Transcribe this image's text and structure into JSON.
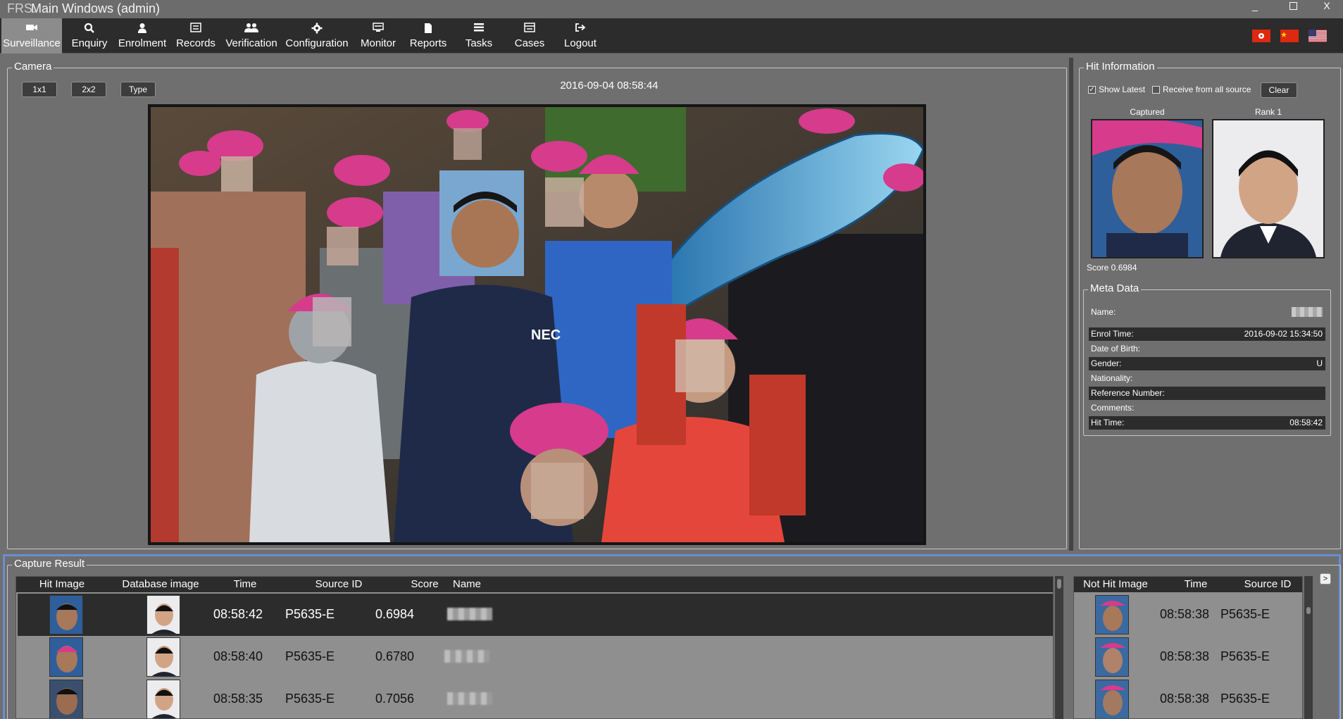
{
  "titlebar": {
    "brand": "FRS.",
    "title": "Main Windows   (admin)",
    "minimize": "_",
    "close": "X"
  },
  "toolbar": {
    "items": [
      {
        "label": "Surveillance",
        "icon": "video-camera-icon"
      },
      {
        "label": "Enquiry",
        "icon": "search-icon"
      },
      {
        "label": "Enrolment",
        "icon": "user-icon"
      },
      {
        "label": "Records",
        "icon": "records-icon"
      },
      {
        "label": "Verification",
        "icon": "users-icon"
      },
      {
        "label": "Configuration",
        "icon": "gear-icon"
      },
      {
        "label": "Monitor",
        "icon": "monitor-icon"
      },
      {
        "label": "Reports",
        "icon": "report-icon"
      },
      {
        "label": "Tasks",
        "icon": "list-icon"
      },
      {
        "label": "Cases",
        "icon": "cases-icon"
      },
      {
        "label": "Logout",
        "icon": "logout-icon"
      }
    ],
    "active": "Surveillance",
    "languages": [
      "hong-kong-flag",
      "china-flag",
      "us-flag"
    ]
  },
  "camera": {
    "legend": "Camera",
    "buttons": {
      "one": "1x1",
      "two": "2x2",
      "type": "Type"
    },
    "timestamp": "2016-09-04 08:58:44",
    "overlay_text": "NEC"
  },
  "hit_information": {
    "legend": "Hit Information",
    "show_latest": {
      "label": "Show Latest",
      "checked": true
    },
    "receive_all": {
      "label": "Receive from all source",
      "checked": false
    },
    "clear": "Clear",
    "captured_label": "Captured",
    "rank_label": "Rank 1",
    "score": "Score 0.6984"
  },
  "meta_data": {
    "legend": "Meta Data",
    "rows": [
      {
        "label": "Name:",
        "value": ""
      },
      {
        "label": "Enrol Time:",
        "value": "2016-09-02 15:34:50"
      },
      {
        "label": "Date of Birth:",
        "value": ""
      },
      {
        "label": "Gender:",
        "value": "U"
      },
      {
        "label": "Nationality:",
        "value": ""
      },
      {
        "label": "Reference Number:",
        "value": ""
      },
      {
        "label": "Comments:",
        "value": ""
      },
      {
        "label": "Hit Time:",
        "value": "08:58:42"
      }
    ]
  },
  "capture_result": {
    "legend": "Capture Result",
    "hit_columns": [
      "Hit Image",
      "Database image",
      "Time",
      "Source ID",
      "Score",
      "Name"
    ],
    "hit_rows": [
      {
        "time": "08:58:42",
        "source": "P5635-E",
        "score": "0.6984",
        "selected": true
      },
      {
        "time": "08:58:40",
        "source": "P5635-E",
        "score": "0.6780",
        "selected": false
      },
      {
        "time": "08:58:35",
        "source": "P5635-E",
        "score": "0.7056",
        "selected": false
      }
    ],
    "nohit_columns": [
      "Not Hit Image",
      "Time",
      "Source ID"
    ],
    "nohit_rows": [
      {
        "time": "08:58:38",
        "source": "P5635-E"
      },
      {
        "time": "08:58:38",
        "source": "P5635-E"
      },
      {
        "time": "08:58:38",
        "source": "P5635-E"
      }
    ],
    "expand": ">"
  },
  "colors": {
    "accent_blue": "#6a8fd0",
    "dark": "#2c2c2c",
    "panel": "#6f6f6f",
    "pink_cap": "#d63b8c"
  }
}
